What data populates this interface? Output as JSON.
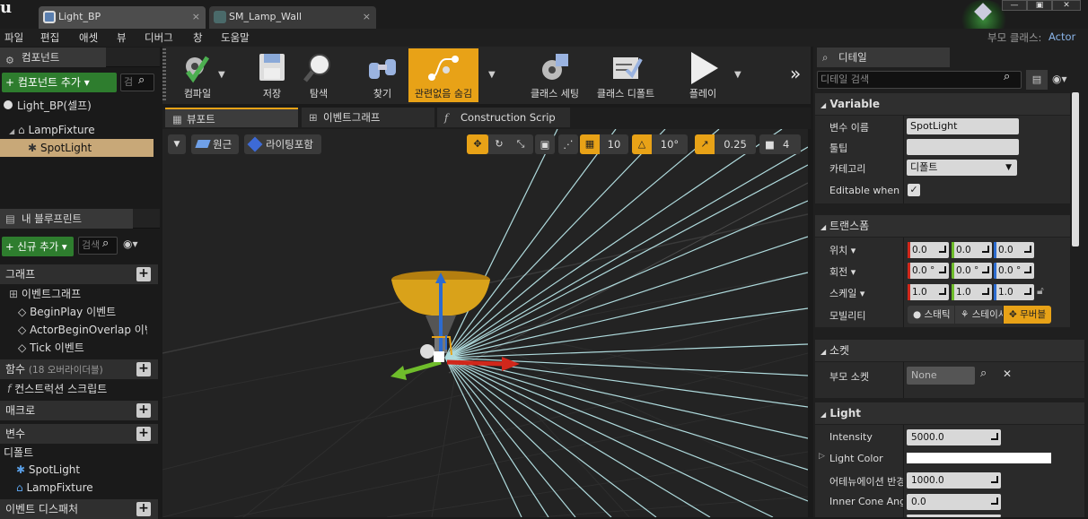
{
  "title_bar": {
    "tabs": [
      {
        "label": "Light_BP",
        "close": "×"
      },
      {
        "label": "SM_Lamp_Wall",
        "close": "×"
      }
    ],
    "parent_class_label": "부모 클래스:",
    "parent_class_value": "Actor"
  },
  "menu": [
    "파일",
    "편집",
    "애셋",
    "뷰",
    "디버그",
    "창",
    "도움말"
  ],
  "components": {
    "title": "컴포넌트",
    "add_button": "+ 컴포넌트 추가 ▾",
    "search_placeholder": "검",
    "items": [
      "Light_BP(셀프)",
      "LampFixture",
      "SpotLight"
    ]
  },
  "my_blueprint": {
    "title": "내 블루프린트",
    "add_button": "+ 신규 추가 ▾",
    "search_placeholder": "검색",
    "sections": {
      "graph": "그래프",
      "event_graph": "이벤트그래프",
      "events": [
        "BeginPlay 이벤트",
        "ActorBeginOverlap 이벤트",
        "Tick 이벤트"
      ],
      "functions": "함수",
      "functions_note": "(18 오버라이더블)",
      "construction_script": "컨스트럭션 스크립트",
      "macros": "매크로",
      "variables": "변수",
      "defaults": "디폴트",
      "variable_items": [
        "SpotLight",
        "LampFixture"
      ],
      "event_dispatchers": "이벤트 디스패처"
    }
  },
  "toolbar": {
    "buttons": [
      "컴파일",
      "저장",
      "탐색",
      "찾기",
      "관련없음 숨김",
      "클래스 세팅",
      "클래스 디폴트",
      "플레이"
    ],
    "overflow": "»"
  },
  "editor_tabs": [
    "뷰포트",
    "이벤트그래프",
    "Construction Scrip"
  ],
  "viewport": {
    "perspective": "원근",
    "lighting": "라이팅포함",
    "grid_snap": "10",
    "rot_snap": "10°",
    "scale_snap": "0.25",
    "camera_speed": "4"
  },
  "details": {
    "title": "디테일",
    "search_placeholder": "디테일 검색",
    "variable_section": "Variable",
    "var_name_label": "변수 이름",
    "var_name_value": "SpotLight",
    "tooltip_label": "툴팁",
    "tooltip_value": "",
    "category_label": "카테고리",
    "category_value": "디폴트",
    "editable_label": "Editable when Inherited",
    "editable_checked": true,
    "transform_section": "트랜스폼",
    "location_label": "위치 ▾",
    "location": [
      "0.0",
      "0.0",
      "0.0"
    ],
    "rotation_label": "회전 ▾",
    "rotation": [
      "0.0 °",
      "0.0 °",
      "0.0 °"
    ],
    "scale_label": "스케일 ▾",
    "scale": [
      "1.0",
      "1.0",
      "1.0"
    ],
    "mobility_label": "모빌리티",
    "mobility_options": [
      "스태틱",
      "스테이셔너리",
      "무버블"
    ],
    "socket_section": "소켓",
    "parent_socket_label": "부모 소켓",
    "parent_socket_value": "None",
    "light_section": "Light",
    "intensity_label": "Intensity",
    "intensity_value": "5000.0",
    "light_color_label": "Light Color",
    "attenuation_label": "어테뉴에이션 반경",
    "attenuation_value": "1000.0",
    "inner_cone_label": "Inner Cone Angle",
    "inner_cone_value": "0.0"
  },
  "colors": {
    "accent_orange": "#e8a217",
    "add_green": "#2e7d2e",
    "selected_row": "#c8a878",
    "x_axis": "#d0271b",
    "y_axis": "#6fbd2b",
    "z_axis": "#2c6bd0"
  }
}
